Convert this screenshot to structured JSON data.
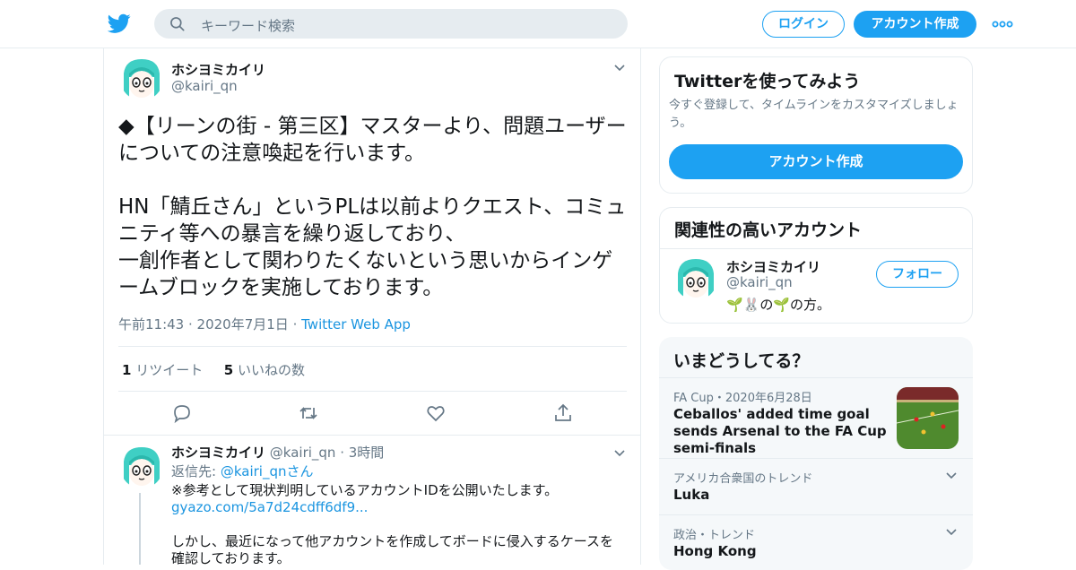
{
  "header": {
    "search_placeholder": "キーワード検索",
    "login_label": "ログイン",
    "signup_label": "アカウント作成",
    "brand_color": "#1da1f2"
  },
  "tweet": {
    "name": "ホシヨミカイリ",
    "handle": "@kairi_qn",
    "text": "◆【リーンの街 - 第三区】マスターより、問題ユーザーについての注意喚起を行います。\n\nHN「鯖丘さん」というPLは以前よりクエスト、コミュニティ等への暴言を繰り返しており、\n一創作者として関わりたくないという思いからインゲームブロックを実施しております。",
    "time": "午前11:43",
    "date": "2020年7月1日",
    "source": "Twitter Web App",
    "retweet_count": "1",
    "retweet_label": "リツイート",
    "like_count": "5",
    "like_label": "いいねの数"
  },
  "reply": {
    "name": "ホシヨミカイリ",
    "handle": "@kairi_qn",
    "age": "3時間",
    "reply_to_prefix": "返信先: ",
    "reply_to_handle": "@kairi_qnさん",
    "line1": "※参考として現状判明しているアカウントIDを公開いたします。",
    "link": "gyazo.com/5a7d24cdff6df9...",
    "line3": "しかし、最近になって他アカウントを作成してボードに侵入するケースを",
    "line4": "確認しております。"
  },
  "signup_card": {
    "title": "Twitterを使ってみよう",
    "subtitle": "今すぐ登録して、タイムラインをカスタマイズしましょう。",
    "button": "アカウント作成"
  },
  "related_card": {
    "title": "関連性の高いアカウント",
    "name": "ホシヨミカイリ",
    "handle": "@kairi_qn",
    "bio": "🌱🐰の🌱の方。",
    "follow_label": "フォロー"
  },
  "trends": {
    "title": "いまどうしてる？",
    "items": [
      {
        "meta": "FA Cup・2020年6月28日",
        "title": "Ceballos' added time goal sends Arsenal to the FA Cup semi-finals"
      },
      {
        "meta": "アメリカ合衆国のトレンド",
        "title": "Luka"
      },
      {
        "meta": "政治・トレンド",
        "title": "Hong Kong"
      }
    ]
  }
}
